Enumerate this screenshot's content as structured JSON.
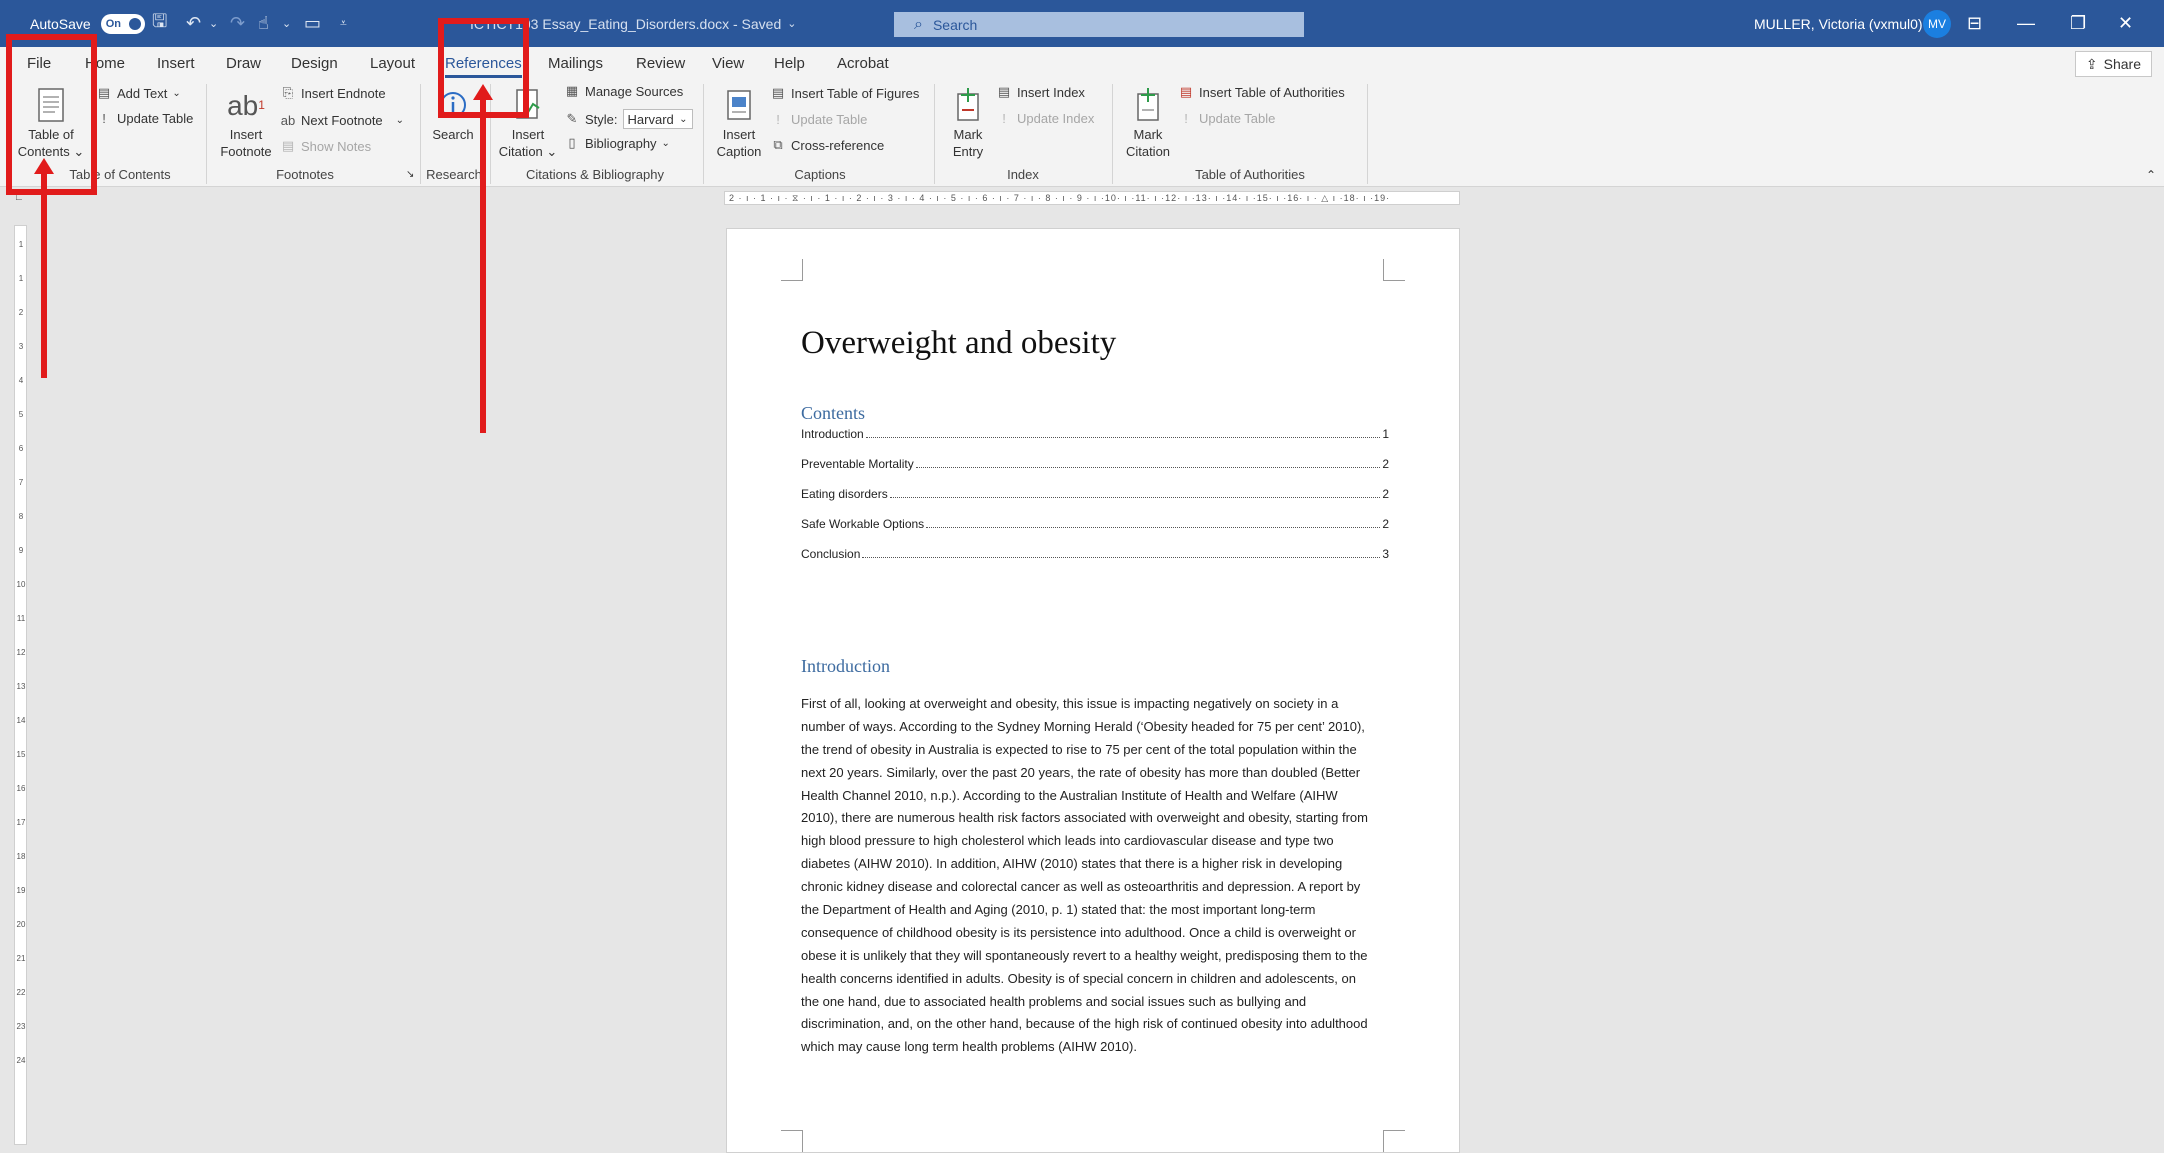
{
  "titlebar": {
    "autosave_label": "AutoSave",
    "autosave_state": "On",
    "doc_title": "ICTICT103 Essay_Eating_Disorders.docx - Saved",
    "search_placeholder": "Search",
    "user_name": "MULLER, Victoria (vxmul0)",
    "user_initials": "MV"
  },
  "menu": {
    "tabs": [
      "File",
      "Home",
      "Insert",
      "Draw",
      "Design",
      "Layout",
      "References",
      "Mailings",
      "Review",
      "View",
      "Help",
      "Acrobat"
    ],
    "active_tab": "References",
    "share_label": "Share"
  },
  "ribbon": {
    "toc": {
      "table_of_contents_line1": "Table of",
      "table_of_contents_line2": "Contents",
      "add_text": "Add Text",
      "update_table": "Update Table",
      "group_label": "Table of Contents"
    },
    "footnotes": {
      "insert_footnote_line1": "Insert",
      "insert_footnote_line2": "Footnote",
      "insert_endnote": "Insert Endnote",
      "next_footnote": "Next Footnote",
      "show_notes": "Show Notes",
      "group_label": "Footnotes"
    },
    "research": {
      "search": "Search",
      "group_label": "Research"
    },
    "citations": {
      "insert_citation_line1": "Insert",
      "insert_citation_line2": "Citation",
      "manage_sources": "Manage Sources",
      "style_label": "Style:",
      "style_value": "Harvard",
      "bibliography": "Bibliography",
      "group_label": "Citations & Bibliography"
    },
    "captions": {
      "insert_caption_line1": "Insert",
      "insert_caption_line2": "Caption",
      "insert_table_of_figures": "Insert Table of Figures",
      "update_table": "Update Table",
      "cross_reference": "Cross-reference",
      "group_label": "Captions"
    },
    "index": {
      "mark_entry_line1": "Mark",
      "mark_entry_line2": "Entry",
      "insert_index": "Insert Index",
      "update_index": "Update Index",
      "group_label": "Index"
    },
    "authorities": {
      "mark_citation_line1": "Mark",
      "mark_citation_line2": "Citation",
      "insert_table_of_authorities": "Insert Table of Authorities",
      "update_table": "Update Table",
      "group_label": "Table of Authorities"
    }
  },
  "ruler": {
    "horizontal": "2 · ı · 1 · ı · ⧖ · ı · 1 · ı · 2 · ı · 3 · ı · 4 · ı · 5 · ı · 6 · ı · 7 · ı · 8 · ı · 9 · ı ·10· ı ·11· ı ·12· ı ·13· ı ·14· ı ·15· ı ·16· ı · △ ı ·18· ı ·19·",
    "vertical_ticks": [
      "1",
      "1",
      "2",
      "3",
      "4",
      "5",
      "6",
      "7",
      "8",
      "9",
      "10",
      "11",
      "12",
      "13",
      "14",
      "15",
      "16",
      "17",
      "18",
      "19",
      "20",
      "21",
      "22",
      "23",
      "24"
    ]
  },
  "document": {
    "title": "Overweight and obesity",
    "contents_heading": "Contents",
    "toc": [
      {
        "text": "Introduction",
        "page": "1"
      },
      {
        "text": "Preventable Mortality",
        "page": "2"
      },
      {
        "text": "Eating disorders",
        "page": "2"
      },
      {
        "text": "Safe Workable Options",
        "page": "2"
      },
      {
        "text": "Conclusion",
        "page": "3"
      }
    ],
    "intro_heading": "Introduction",
    "body_lines": [
      "First of all, looking at overweight and obesity, this issue is impacting negatively on society in a",
      "number of ways. According to the Sydney Morning Herald (‘Obesity headed for 75 per cent’ 2010),",
      "the trend of obesity in Australia is expected to rise to 75 per cent of the total population within the",
      "next 20 years. Similarly, over the past 20 years, the rate of obesity has more than doubled (Better",
      "Health Channel 2010, n.p.). According to the Australian Institute of Health and Welfare (AIHW",
      "2010), there are numerous health risk factors associated with overweight and obesity, starting from",
      "high blood pressure to high cholesterol which leads into cardiovascular disease and type two",
      "diabetes (AIHW 2010). In addition, AIHW (2010)   states that there is a higher risk in developing",
      "chronic kidney disease and colorectal cancer as well as osteoarthritis and depression.  A report by",
      "the Department of Health and Aging (2010, p. 1) stated that:  the most important long-term",
      "consequence of childhood obesity is its persistence into adulthood. Once a child is overweight or",
      "obese it is unlikely that they will spontaneously revert to a healthy weight, predisposing them to the",
      "health concerns identified in adults. Obesity is of special concern in children and adolescents, on",
      "the one hand, due to associated health problems and social issues such as bullying and",
      "discrimination, and, on the other hand, because of the high risk of continued obesity into adulthood",
      "which may cause long term health problems (AIHW 2010)."
    ]
  },
  "colors": {
    "titlebar": "#2b579a",
    "annotation": "#e11b1b",
    "heading": "#3d6ba0"
  }
}
